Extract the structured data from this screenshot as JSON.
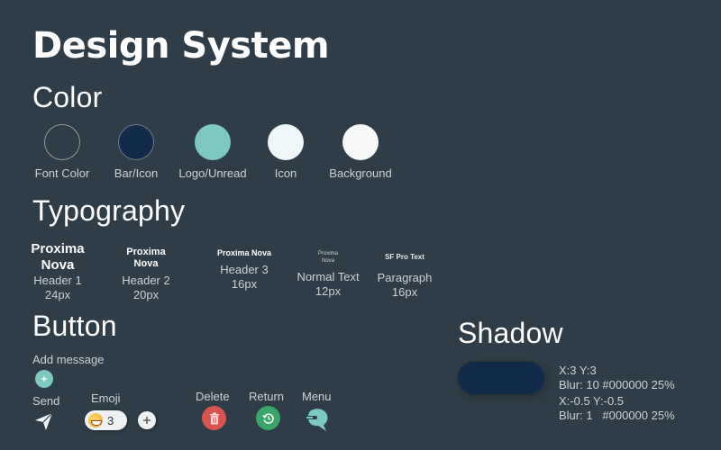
{
  "page": {
    "title": "Design System",
    "background": "#2e3d47"
  },
  "color_section": {
    "heading": "Color",
    "swatches": [
      {
        "label": "Font Color",
        "color": "#2e3d47",
        "outlined": true
      },
      {
        "label": "Bar/Icon",
        "color": "#132b4a",
        "outlined": true
      },
      {
        "label": "Logo/Unread",
        "color": "#7dc8bf",
        "outlined": false
      },
      {
        "label": "Icon",
        "color": "#eef6fa",
        "outlined": false
      },
      {
        "label": "Background",
        "color": "#f7f8f8",
        "outlined": false
      }
    ]
  },
  "typography_section": {
    "heading": "Typography",
    "items": [
      {
        "sample": "Proxima Nova",
        "name": "Header 1",
        "size": "24px"
      },
      {
        "sample": "Proxima Nova",
        "name": "Header 2",
        "size": "20px"
      },
      {
        "sample": "Proxima Nova",
        "name": "Header 3",
        "size": "16px"
      },
      {
        "sample": "Proxima Nova",
        "name": "Normal Text",
        "size": "12px"
      },
      {
        "sample": "SF Pro Text",
        "name": "Paragraph",
        "size": "16px"
      }
    ]
  },
  "button_section": {
    "heading": "Button",
    "add_message": {
      "label": "Add message",
      "icon": "plus-icon",
      "color": "#7dc8bf"
    },
    "send": {
      "label": "Send",
      "icon": "send-icon"
    },
    "emoji": {
      "label": "Emoji",
      "icon": "grinning-face-icon",
      "count": "3",
      "add_icon": "plus-icon"
    },
    "delete": {
      "label": "Delete",
      "icon": "trash-icon",
      "color": "#d9534f"
    },
    "return": {
      "label": "Return",
      "icon": "restore-icon",
      "color": "#3aa66a"
    },
    "menu": {
      "label": "Menu",
      "icon": "menu-logo-icon",
      "color": "#7dc8bf"
    }
  },
  "shadow_section": {
    "heading": "Shadow",
    "sample_color": "#132b4a",
    "specs": [
      {
        "offset": "X:3 Y:3",
        "blur": "Blur: 10 #000000 25%"
      },
      {
        "offset": "X:-0.5 Y:-0.5",
        "blur": "Blur: 1   #000000 25%"
      }
    ]
  }
}
